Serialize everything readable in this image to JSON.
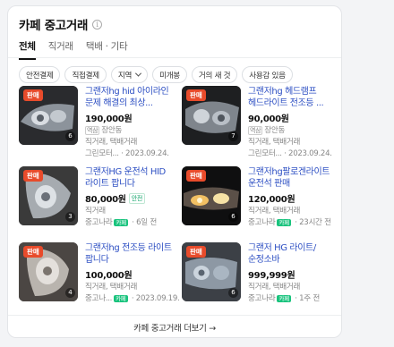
{
  "header": {
    "title": "카페 중고거래",
    "info_icon": "info-icon"
  },
  "tabs": [
    {
      "label": "전체",
      "active": true
    },
    {
      "label": "직거래",
      "active": false
    },
    {
      "label": "택배 · 기타",
      "active": false
    }
  ],
  "filters": [
    {
      "label": "안전결제"
    },
    {
      "label": "직접결제"
    },
    {
      "label": "지역",
      "has_dropdown": true
    },
    {
      "label": "미개봉"
    },
    {
      "label": "거의 새 것"
    },
    {
      "label": "사용감 있음"
    }
  ],
  "items": [
    {
      "badge": "판매",
      "index": "6",
      "title": "그랜저hg hid 아이라인 문제 해결의 최상...",
      "price": "190,000원",
      "loc_tag": "역삼",
      "location": "장안동",
      "trade": "직거래, 택배거래",
      "source": "그린모터...",
      "date": "2023.09.24."
    },
    {
      "badge": "판매",
      "index": "7",
      "title": "그랜저hg 헤드램프 헤드라이트 전조등 ...",
      "price": "90,000원",
      "loc_tag": "역삼",
      "location": "장안동",
      "trade": "직거래, 택배거래",
      "source": "그린모터...",
      "date": "2023.09.24."
    },
    {
      "badge": "판매",
      "index": "3",
      "title": "그랜저HG 운전석 HID 라이트 팝니다",
      "price": "80,000원",
      "safe": "안전",
      "trade": "직거래",
      "source": "중고나라",
      "cafe": "카페",
      "date": "6일 전"
    },
    {
      "badge": "판매",
      "index": "6",
      "title": "그랜저hg팔로겐라이트 운전석 판매",
      "price": "120,000원",
      "trade": "직거래, 택배거래",
      "source": "중고나라",
      "cafe": "카페",
      "date": "23시간 전"
    },
    {
      "badge": "판매",
      "index": "4",
      "title": "그랜저hg 전조등 라이트 팝니다",
      "price": "100,000원",
      "trade": "직거래, 택배거래",
      "source": "중고나...",
      "cafe": "카페",
      "date": "2023.09.19."
    },
    {
      "badge": "판매",
      "index": "6",
      "title": "그랜저 HG 라이트/순정소바",
      "price": "999,999원",
      "trade": "직거래, 택배거래",
      "source": "중고나라",
      "cafe": "카페",
      "date": "1주 전"
    }
  ],
  "more_link": "카페 중고거래 더보기 →",
  "colors": {
    "title_link": "#2d4fc3",
    "badge": "#e84b2b",
    "cafe_tag": "#19c37d"
  }
}
